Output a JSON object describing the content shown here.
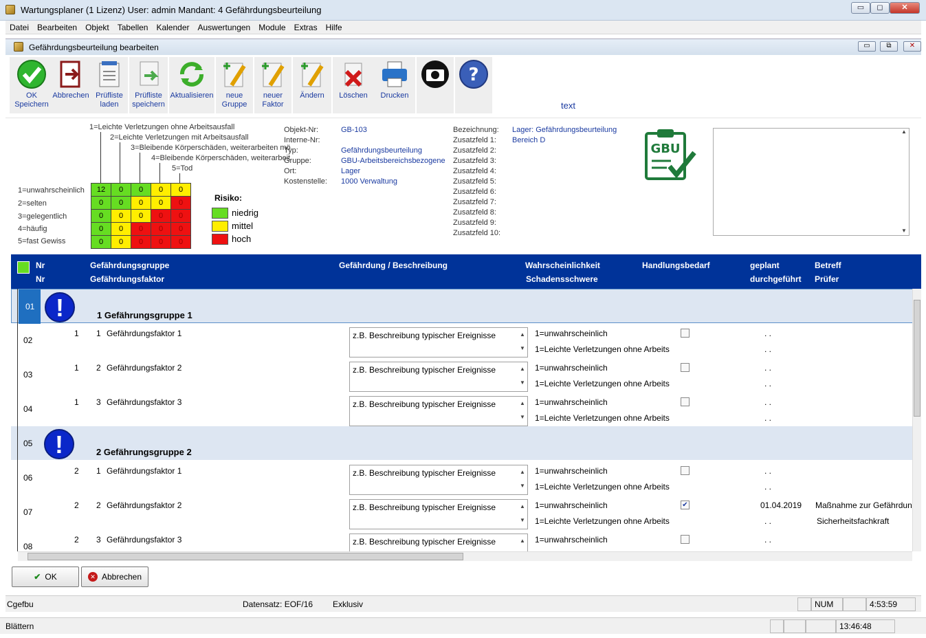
{
  "window": {
    "title": "Wartungsplaner  (1 Lizenz)    User: admin Mandant: 4 Gefährdungsbeurteilung",
    "min": "▭",
    "max": "◻",
    "close": "✕"
  },
  "menu": [
    "Datei",
    "Bearbeiten",
    "Objekt",
    "Tabellen",
    "Kalender",
    "Auswertungen",
    "Module",
    "Extras",
    "Hilfe"
  ],
  "subwindow": {
    "title": "Gefährdungsbeurteilung bearbeiten",
    "min": "▭",
    "max": "⧉",
    "close": "✕"
  },
  "toolbar": {
    "ok_l1": "OK",
    "ok_l2": "Speichern",
    "cancel": "Abbrechen",
    "load_l1": "Prüfliste",
    "load_l2": "laden",
    "save_l1": "Prüfliste",
    "save_l2": "speichern",
    "refresh": "Aktualisieren",
    "newgroup_l1": "neue",
    "newgroup_l2": "Gruppe",
    "newfactor_l1": "neuer",
    "newfactor_l2": "Faktor",
    "edit": "Ändern",
    "delete": "Löschen",
    "print": "Drucken",
    "text": "text"
  },
  "severity": [
    "1=Leichte Verletzungen ohne Arbeitsausfall",
    "2=Leichte Verletzungen mit Arbeitsausfall",
    "3=Bleibende Körperschäden, weiterarbeiten mö",
    "4=Bleibende Körperschäden, weiterarbeit",
    "5=Tod"
  ],
  "likelihood": [
    "1=unwahrscheinlich",
    "2=selten",
    "3=gelegentlich",
    "4=häufig",
    "5=fast Gewiss"
  ],
  "matrix": [
    [
      "12",
      "0",
      "0",
      "0",
      "0"
    ],
    [
      "0",
      "0",
      "0",
      "0",
      "0"
    ],
    [
      "0",
      "0",
      "0",
      "0",
      "0"
    ],
    [
      "0",
      "0",
      "0",
      "0",
      "0"
    ],
    [
      "0",
      "0",
      "0",
      "0",
      "0"
    ]
  ],
  "risk": {
    "title": "Risiko:",
    "low": "niedrig",
    "mid": "mittel",
    "high": "hoch",
    "colors": {
      "low": "#66dd22",
      "mid": "#ffee00",
      "high": "#ee1111"
    }
  },
  "object": {
    "labels": [
      "Objekt-Nr:",
      "Interne-Nr:",
      "Typ:",
      "Gruppe:",
      "Ort:",
      "Kostenstelle:"
    ],
    "values": [
      "GB-103",
      "",
      "Gefährdungsbeurteilung",
      "GBU-Arbeitsbereichsbezogene",
      "Lager",
      "1000 Verwaltung"
    ]
  },
  "fields": {
    "labels": [
      "Bezeichnung:",
      "Zusatzfeld 1:",
      "Zusatzfeld 2:",
      "Zusatzfeld 3:",
      "Zusatzfeld 4:",
      "Zusatzfeld 5:",
      "Zusatzfeld 6:",
      "Zusatzfeld 7:",
      "Zusatzfeld 8:",
      "Zusatzfeld 9:",
      "Zusatzfeld 10:"
    ],
    "values": [
      "Lager: Gefährdungsbeurteilung",
      "Bereich D"
    ]
  },
  "logo": "GBU",
  "header": {
    "nr": "Nr",
    "nr2": "Nr",
    "group": "Gefährdungsgruppe",
    "factor": "Gefährdungsfaktor",
    "desc": "Gefährdung / Beschreibung",
    "wahr": "Wahrscheinlichkeit",
    "schaden": "Schadensschwere",
    "hand": "Handlungsbedarf",
    "geplant": "geplant",
    "durch": "durchgeführt",
    "betreff": "Betreff",
    "pruefer": "Prüfer"
  },
  "rows": [
    {
      "nr": "01",
      "type": "group",
      "label": "1  Gefährungsgruppe 1"
    },
    {
      "nr": "02",
      "type": "item",
      "g": "1",
      "f": "1",
      "label": "Gefährdungsfaktor 1",
      "desc": "z.B. Beschreibung typischer Ereignisse",
      "w": "1=unwahrscheinlich",
      "s": "1=Leichte Verletzungen ohne Arbeits",
      "checked": false,
      "planned": ". .",
      "done": ". .",
      "betreff": "",
      "pruefer": ""
    },
    {
      "nr": "03",
      "type": "item",
      "g": "1",
      "f": "2",
      "label": "Gefährdungsfaktor 2",
      "desc": "z.B. Beschreibung typischer Ereignisse",
      "w": "1=unwahrscheinlich",
      "s": "1=Leichte Verletzungen ohne Arbeits",
      "checked": false,
      "planned": ". .",
      "done": ". .",
      "betreff": "",
      "pruefer": ""
    },
    {
      "nr": "04",
      "type": "item",
      "g": "1",
      "f": "3",
      "label": "Gefährdungsfaktor 3",
      "desc": "z.B. Beschreibung typischer Ereignisse",
      "w": "1=unwahrscheinlich",
      "s": "1=Leichte Verletzungen ohne Arbeits",
      "checked": false,
      "planned": ". .",
      "done": ". .",
      "betreff": "",
      "pruefer": ""
    },
    {
      "nr": "05",
      "type": "group",
      "label": "2  Gefährungsgruppe 2"
    },
    {
      "nr": "06",
      "type": "item",
      "g": "2",
      "f": "1",
      "label": "Gefährdungsfaktor 1",
      "desc": "z.B. Beschreibung typischer Ereignisse",
      "w": "1=unwahrscheinlich",
      "s": "1=Leichte Verletzungen ohne Arbeits",
      "checked": false,
      "planned": ". .",
      "done": ". .",
      "betreff": "",
      "pruefer": ""
    },
    {
      "nr": "07",
      "type": "item",
      "g": "2",
      "f": "2",
      "label": "Gefährdungsfaktor 2",
      "desc": "z.B. Beschreibung typischer Ereignisse",
      "w": "1=unwahrscheinlich",
      "s": "1=Leichte Verletzungen ohne Arbeits",
      "checked": true,
      "planned": "01.04.2019",
      "done": ". .",
      "betreff": "Maßnahme zur Gefährdun",
      "pruefer": "Sicherheitsfachkraft"
    },
    {
      "nr": "08",
      "type": "item",
      "g": "2",
      "f": "3",
      "label": "Gefährdungsfaktor 3",
      "desc": "z.B. Beschreibung typischer Ereignisse",
      "w": "1=unwahrscheinlich",
      "s": "",
      "checked": false,
      "planned": ". .",
      "done": "",
      "betreff": "",
      "pruefer": ""
    }
  ],
  "buttons": {
    "ok": "OK",
    "cancel": "Abbrechen"
  },
  "status1": {
    "form": "Cgefbu",
    "record": "Datensatz: EOF/16",
    "mode": "Exklusiv",
    "num": "NUM",
    "time": "4:53:59"
  },
  "status2": {
    "text": "Blättern",
    "time": "13:46:48"
  }
}
